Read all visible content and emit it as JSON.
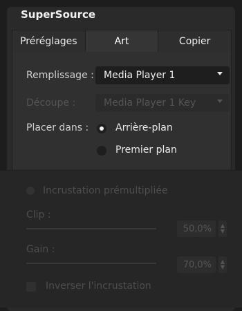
{
  "panel": {
    "title": "SuperSource"
  },
  "tabs": [
    {
      "label": "Préréglages"
    },
    {
      "label": "Art"
    },
    {
      "label": "Copier"
    }
  ],
  "art": {
    "fill_label": "Remplissage :",
    "fill_value": "Media Player 1",
    "cut_label": "Découpe :",
    "cut_value": "Media Player 1 Key",
    "place_label": "Placer dans :",
    "place_options": [
      {
        "label": "Arrière-plan",
        "selected": true
      },
      {
        "label": "Premier plan",
        "selected": false
      }
    ]
  },
  "key": {
    "premultiplied_label": "Incrustation prémultipliée",
    "clip_label": "Clip :",
    "clip_value": "50,0%",
    "gain_label": "Gain :",
    "gain_value": "70,0%",
    "invert_label": "Inverser l'incrustation"
  },
  "colors": {
    "background": "#1d1d1d",
    "panel": "#2a2a2a",
    "field": "#1e1e1e"
  }
}
